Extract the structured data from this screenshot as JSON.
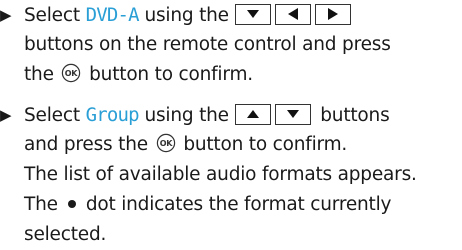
{
  "step1": {
    "select_word": "Select",
    "item": "DVD-A",
    "using_the": "using the",
    "buttons_on": "buttons on the remote control and press",
    "the_word": "the",
    "button_confirm": "button to confirm.",
    "keys": [
      "down-arrow-key",
      "left-arrow-key",
      "right-arrow-key"
    ]
  },
  "step2": {
    "select_word": "Select",
    "item": "Group",
    "using_the": "using the",
    "buttons_word": "buttons",
    "and_press": "and press the",
    "button_confirm": "button to confirm.",
    "result": "The list of available audio formats appears.",
    "the_word": "The",
    "dot_text": "dot indicates the format currently",
    "selected": "selected.",
    "keys": [
      "up-arrow-key",
      "down-arrow-key"
    ]
  },
  "ok_label": "OK",
  "colors": {
    "highlight": "#2a9fd6",
    "text": "#1a1a1a"
  }
}
